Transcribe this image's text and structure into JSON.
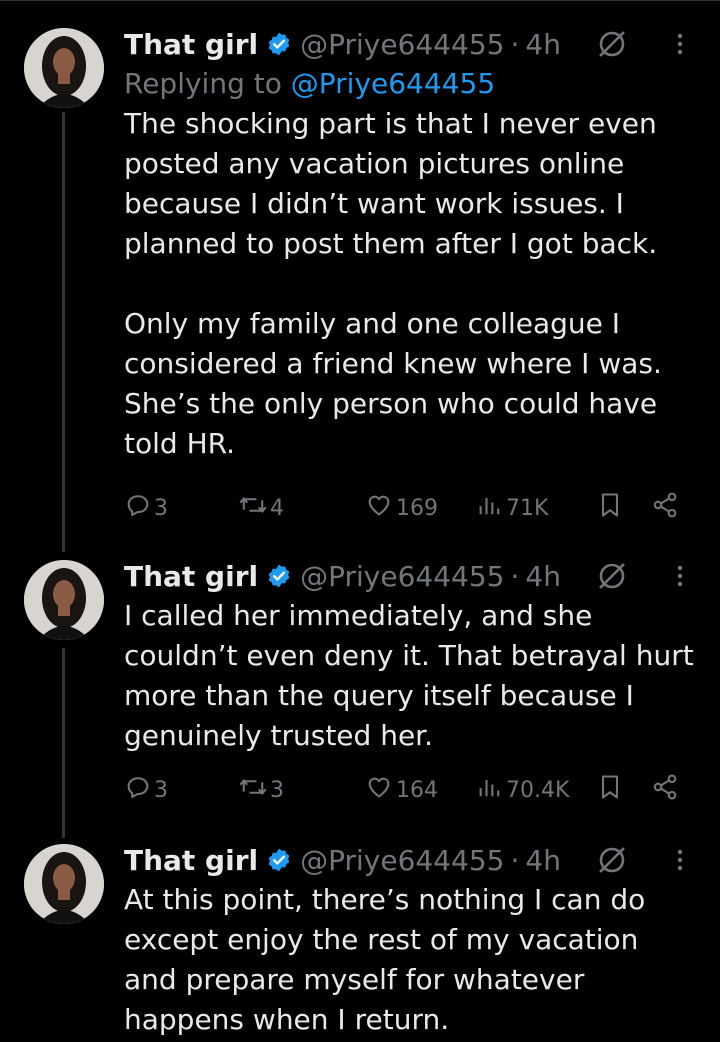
{
  "tweets": [
    {
      "name": "That girl",
      "handle": "@Priye644455",
      "sep": "·",
      "time": "4h",
      "reply_prefix": "Replying to ",
      "reply_to": "@Priye644455",
      "paragraphs": [
        "The shocking part is that I never even posted any vacation pictures online because I didn’t want work issues. I planned to post them after I got back.",
        "Only my family and one colleague I considered a friend knew where I was. She’s the only person who could have told HR."
      ],
      "replies": "3",
      "reposts": "4",
      "likes": "169",
      "views": "71K"
    },
    {
      "name": "That girl",
      "handle": "@Priye644455",
      "sep": "·",
      "time": "4h",
      "paragraphs": [
        "I called her immediately, and she couldn’t even deny it. That betrayal hurt more than the query itself because I genuinely trusted her."
      ],
      "replies": "3",
      "reposts": "3",
      "likes": "164",
      "views": "70.4K"
    },
    {
      "name": "That girl",
      "handle": "@Priye644455",
      "sep": "·",
      "time": "4h",
      "paragraphs": [
        "At this point, there’s nothing I can do except enjoy the rest of my vacation and prepare myself for whatever happens when I return."
      ]
    }
  ],
  "colors": {
    "background": "#000000",
    "text": "#e7e9ea",
    "muted": "#71767b",
    "accent": "#1d9bf0",
    "thread_line": "#333639"
  },
  "icons": [
    "verified-badge-icon",
    "grok-icon",
    "more-icon",
    "reply-icon",
    "repost-icon",
    "like-icon",
    "views-icon",
    "bookmark-icon",
    "share-icon"
  ]
}
